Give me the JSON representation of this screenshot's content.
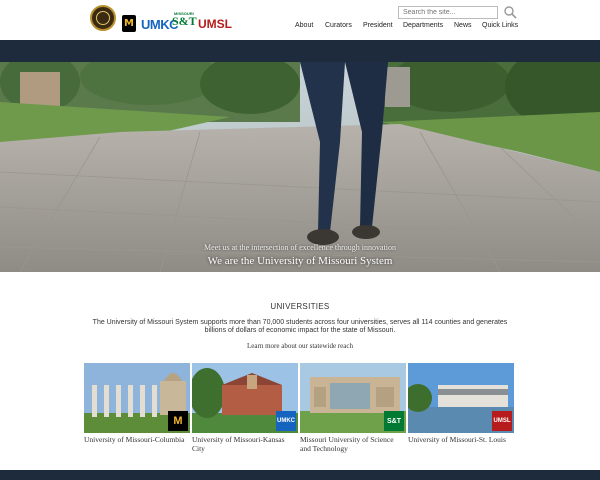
{
  "header": {
    "logos": {
      "system_seal": "university-seal-icon",
      "mizzou": "tiger-head-icon",
      "umkc": "UMKC",
      "missouri_st_top": "MISSOURI",
      "missouri_st": "S&T",
      "umsl": "UMSL"
    },
    "search": {
      "placeholder": "Search the site...",
      "icon": "magnifier-icon"
    },
    "nav": [
      {
        "label": "About"
      },
      {
        "label": "Curators"
      },
      {
        "label": "President"
      },
      {
        "label": "Departments"
      },
      {
        "label": "News"
      },
      {
        "label": "Quick Links"
      }
    ]
  },
  "hero": {
    "subtitle": "Meet us at the intersection of excellence through innovation",
    "title": "We are the University of Missouri System"
  },
  "universities": {
    "heading": "UNIVERSITIES",
    "description": "The University of Missouri System supports more than 70,000 students across four universities, serves all 114 counties and generates billions of dollars of economic impact for the state of Missouri.",
    "link": "Learn more about our statewide reach",
    "cards": [
      {
        "name": "University of Missouri-Columbia",
        "badge": "tiger-head-icon"
      },
      {
        "name": "University of Missouri-Kansas City",
        "badge": "UMKC"
      },
      {
        "name": "Missouri University of Science and Technology",
        "badge": "S&T"
      },
      {
        "name": "University of Missouri-St. Louis",
        "badge": "UMSL"
      }
    ]
  },
  "colors": {
    "band": "#1d2b3d",
    "umkc": "#1565c0",
    "st": "#007a33",
    "umsl": "#b71c1c",
    "mizzou_gold": "#f1b82d"
  }
}
